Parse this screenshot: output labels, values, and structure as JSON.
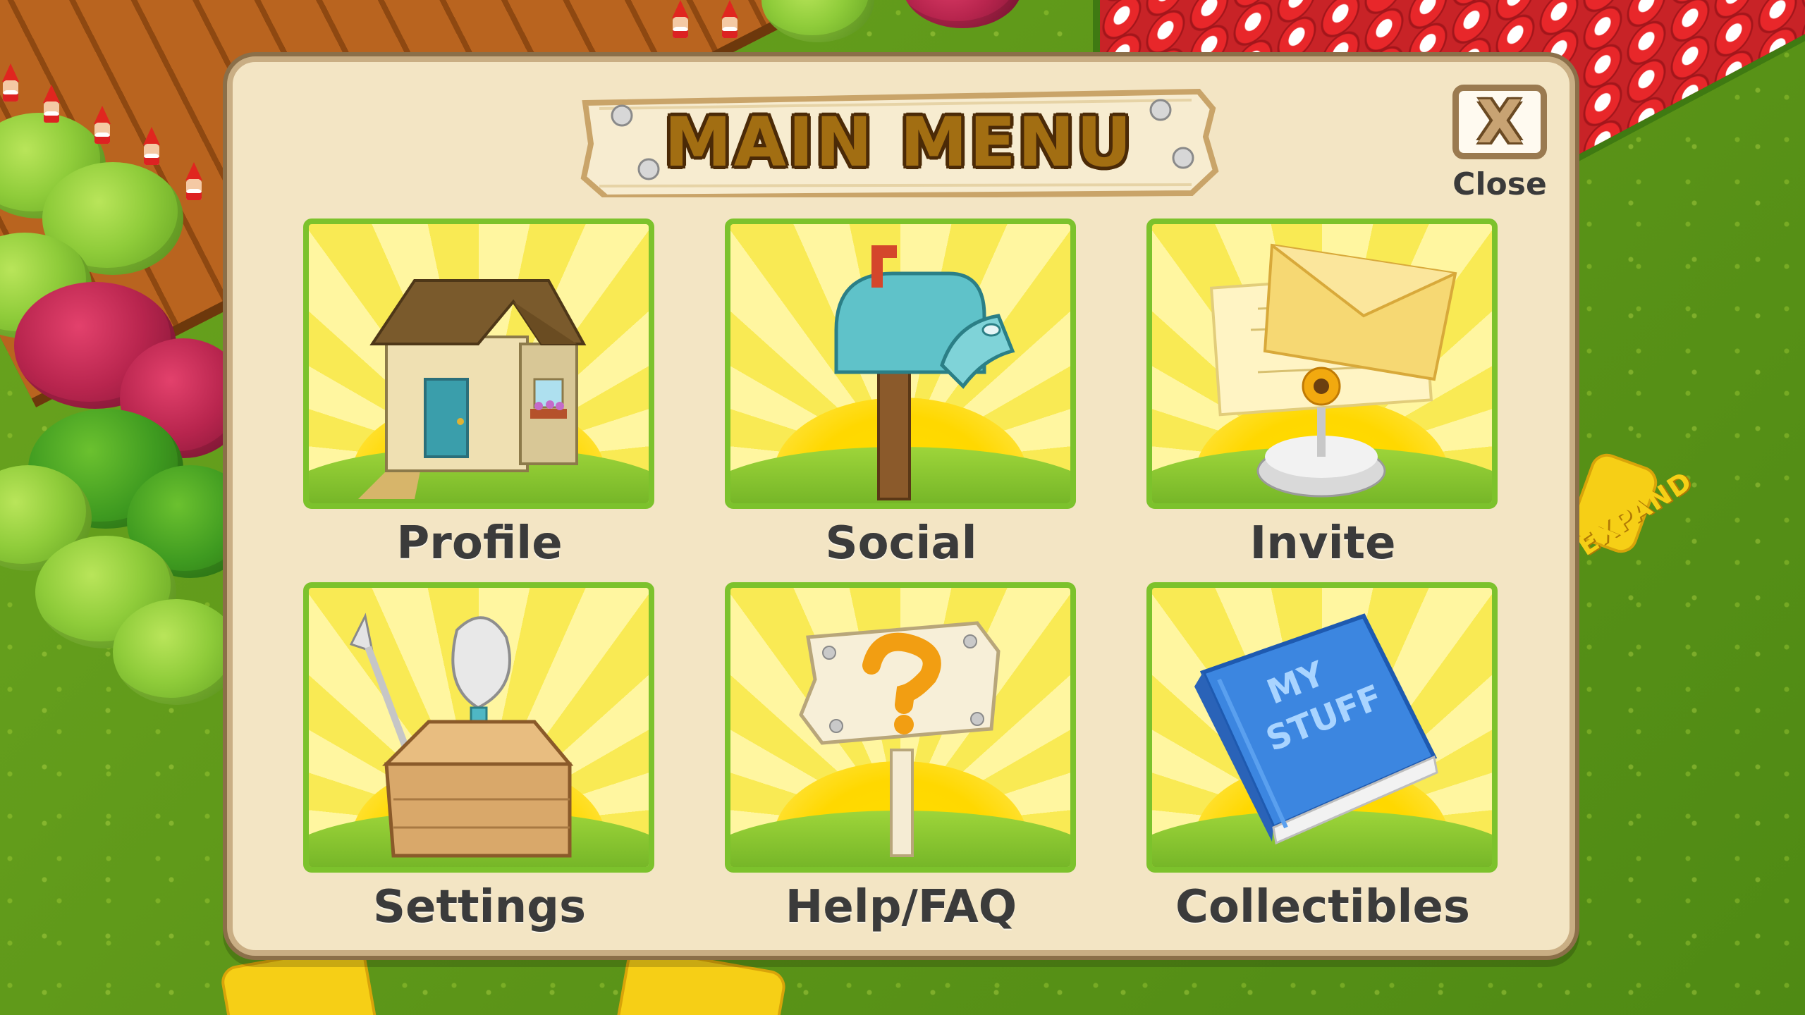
{
  "menu": {
    "title": "MAIN MENU",
    "close_icon_glyph": "X",
    "close_label": "Close"
  },
  "tiles": [
    {
      "label": "Profile",
      "icon": "house-icon"
    },
    {
      "label": "Social",
      "icon": "mailbox-icon"
    },
    {
      "label": "Invite",
      "icon": "invitation-icon"
    },
    {
      "label": "Settings",
      "icon": "toolbox-icon"
    },
    {
      "label": "Help/FAQ",
      "icon": "question-sign-icon"
    },
    {
      "label": "Collectibles",
      "icon": "book-icon",
      "icon_text": [
        "MY",
        "STUFF"
      ]
    }
  ],
  "background": {
    "expand_sign": "EXPAND"
  },
  "colors": {
    "panel": "#f3e5c4",
    "tile_border": "#7cc22c",
    "label_text": "#3b3b3b",
    "title_fill": "#a26e12"
  }
}
